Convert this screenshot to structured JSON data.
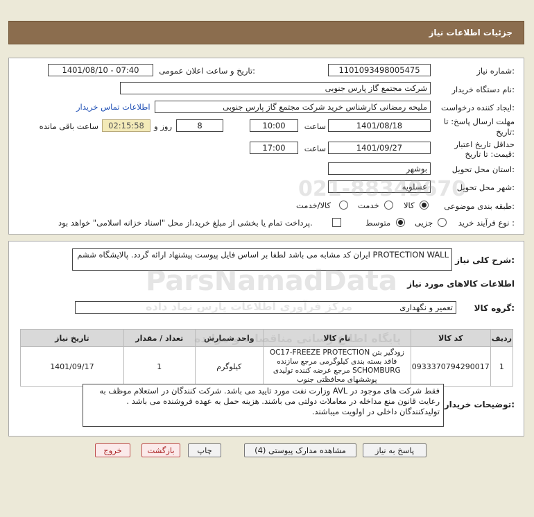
{
  "header": {
    "title": "جزئیات اطلاعات نیاز"
  },
  "form": {
    "need_number_label": "شماره نیاز:",
    "need_number": "1101093498005475",
    "announce_label": "تاریخ و ساعت اعلان عمومی:",
    "announce_value": "1401/08/10 - 07:40",
    "buyer_org_label": "نام دستگاه خریدار:",
    "buyer_org": "شرکت مجتمع گاز پارس جنوبی",
    "requester_label": "ایجاد کننده درخواست:",
    "requester": "ملیحه رمضانی کارشناس خرید  شرکت مجتمع گاز پارس جنوبی",
    "contact_link": "اطلاعات تماس خریدار",
    "reply_deadline_label_1": "مهلت ارسال پاسخ: تا",
    "reply_deadline_label_2": "تاریخ:",
    "reply_date": "1401/08/18",
    "time_label": "ساعت",
    "reply_time": "10:00",
    "days_value": "8",
    "days_label": "روز و",
    "remaining_value": "02:15:58",
    "remaining_label": "ساعت باقی مانده",
    "price_validity_label_1": "حداقل تاریخ اعتبار",
    "price_validity_label_2": "قیمت: تا تاریخ:",
    "validity_date": "1401/09/27",
    "validity_time_label": "ساعت",
    "validity_time": "17:00",
    "province_label": "استان محل تحویل:",
    "province": "بوشهر",
    "city_label": "شهر محل تحویل:",
    "city": "عسلویه",
    "category_label": "طبقه بندی موضوعی:",
    "category_options": [
      "کالا",
      "خدمت",
      "کالا/خدمت"
    ],
    "process_label": "نوع فرآیند خرید :",
    "process_options": [
      "جزیی",
      "متوسط"
    ],
    "payment_note": "پرداخت تمام یا بخشی از مبلغ خرید،از محل \"اسناد خزانه اسلامی\" خواهد بود."
  },
  "description": {
    "label": "شرح کلی نیاز:",
    "text": "PROTECTION WALL ایران کد مشابه می باشد لطفا بر اساس فایل پیوست پیشنهاد ارائه گردد. پالایشگاه ششم"
  },
  "goods": {
    "section_title": "اطلاعات کالاهای مورد نیاز",
    "group_label": "گروه کالا:",
    "group_value": "تعمیر و نگهداری",
    "columns": [
      "ردیف",
      "کد کالا",
      "نام کالا",
      "واحد شمارش",
      "تعداد / مقدار",
      "تاریخ نیاز"
    ],
    "rows": [
      {
        "row": "1",
        "code": "0933370794290017",
        "name": "زودگیر بتن OC17-FREEZE PROTECTION فاقد بسته بندی کیلوگرمی مرجع سازنده SCHOMBURG مرجع عرضه کننده تولیدی پوششهای محافظتی جنوب",
        "unit": "کیلوگرم",
        "qty": "1",
        "date": "1401/09/17"
      }
    ]
  },
  "buyer_notes": {
    "label": "توضیحات خریدار:",
    "text": "فقط شرکت های موجود در AVL وزارت نفت مورد تایید می باشد. شرکت کنندگان در استعلام موظف به رعایت قانون منع مداخله در معاملات دولتی می باشند. هزینه حمل به عهده فروشنده می باشد . تولیدکنندگان داخلی در اولویت میباشند."
  },
  "buttons": {
    "reply": "پاسخ به نیاز",
    "attachments": "مشاهده مدارک پیوستی (4)",
    "print": "چاپ",
    "back": "بازگشت",
    "exit": "خروج"
  },
  "watermark": {
    "brand": "ParsNamadData",
    "subtitle": "مرکز فرآوری اطلاعات پارس نماد داده",
    "line2": "پایگاه اطلاع رسانی مناقصات و مزایده",
    "phone": "021-88349670"
  }
}
